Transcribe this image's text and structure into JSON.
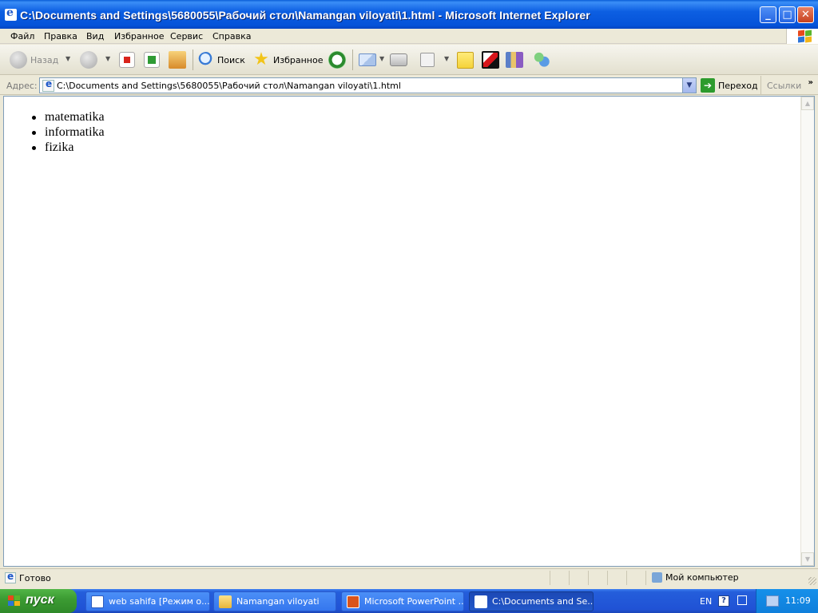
{
  "window": {
    "title": "C:\\Documents and Settings\\5680055\\Рабочий стол\\Namangan viloyati\\1.html - Microsoft Internet Explorer",
    "buttons": {
      "minimize": "_",
      "maximize": "□",
      "close": "✕"
    }
  },
  "menu": {
    "items": [
      "Файл",
      "Правка",
      "Вид",
      "Избранное",
      "Сервис",
      "Справка"
    ]
  },
  "toolbar": {
    "back_label": "Назад",
    "search_label": "Поиск",
    "favorites_label": "Избранное"
  },
  "address": {
    "label": "Адрес:",
    "value": "C:\\Documents and Settings\\5680055\\Рабочий стол\\Namangan viloyati\\1.html",
    "go_label": "Переход",
    "links_label": "Ссылки"
  },
  "page": {
    "list_items": [
      "matematika",
      "informatika",
      "fizika"
    ]
  },
  "status": {
    "text": "Готово",
    "zone": "Мой компьютер"
  },
  "taskbar": {
    "start_label": "пуск",
    "tasks": [
      "web sahifa [Режим о...",
      "Namangan viloyati",
      "Microsoft PowerPoint ...",
      "C:\\Documents and Se..."
    ],
    "language": "EN",
    "help": "?",
    "clock": "11:09"
  }
}
